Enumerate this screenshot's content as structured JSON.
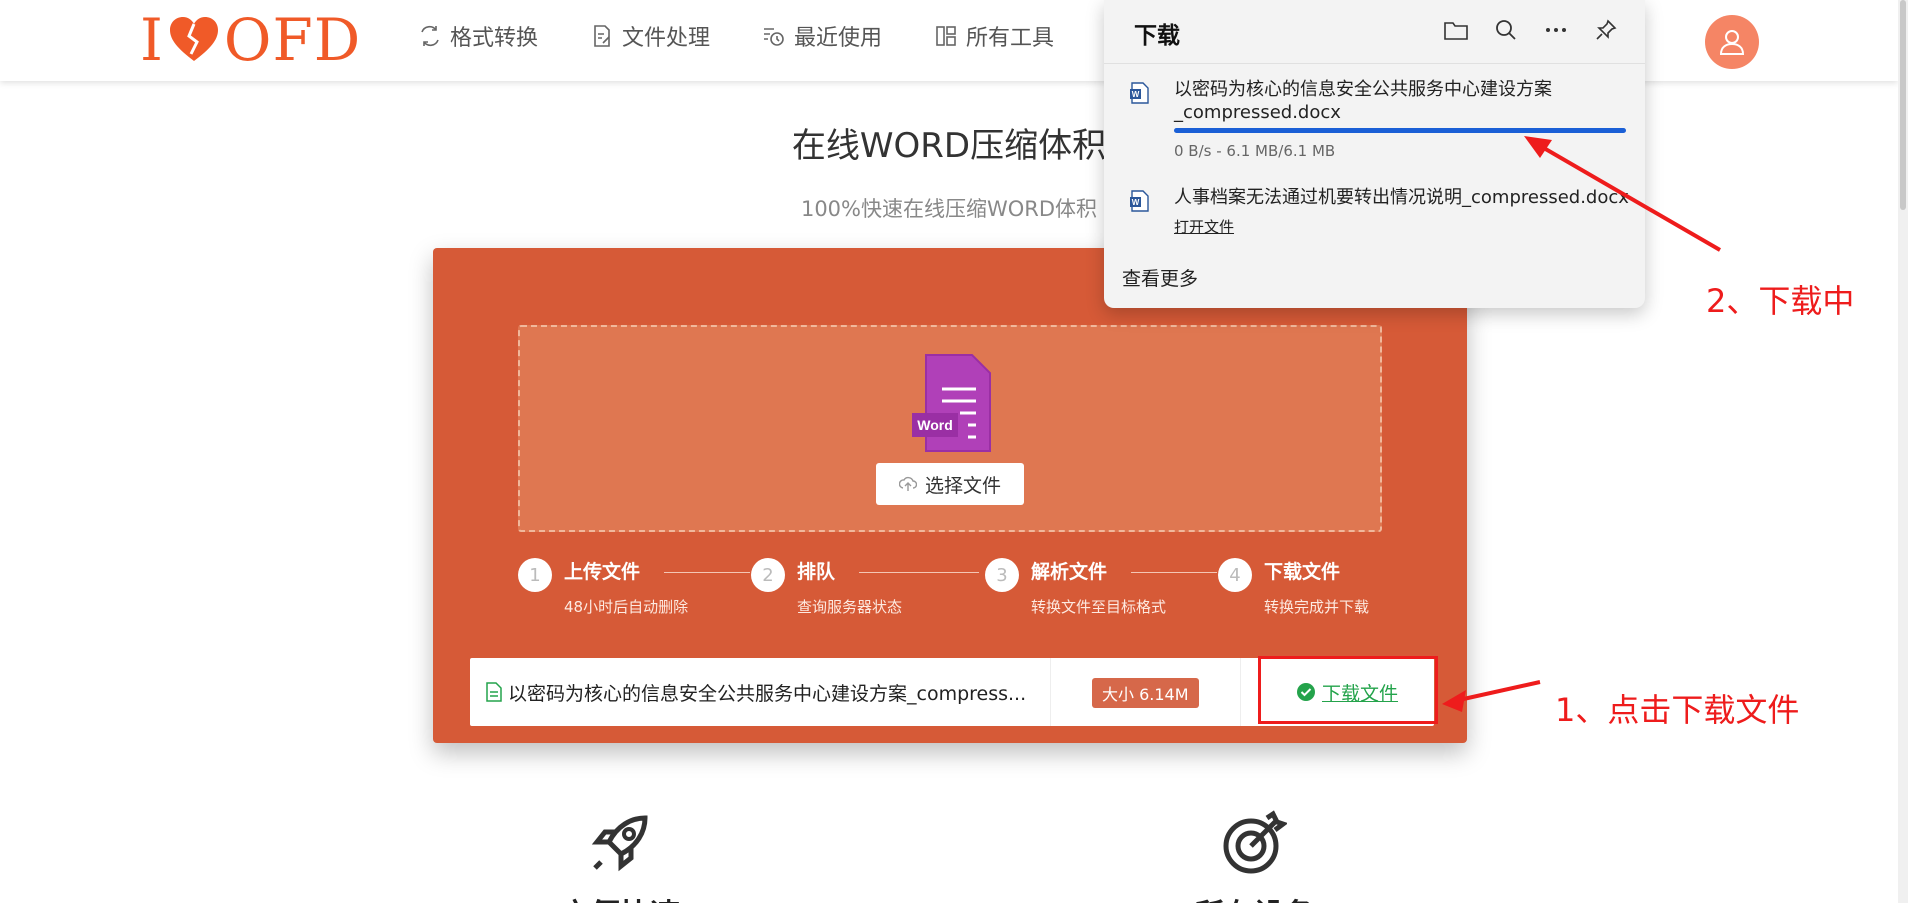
{
  "header": {
    "logo": {
      "pre": "I",
      "post": "OFD"
    },
    "nav": [
      {
        "label": "格式转换",
        "icon": "convert-icon"
      },
      {
        "label": "文件处理",
        "icon": "file-edit-icon"
      },
      {
        "label": "最近使用",
        "icon": "history-icon"
      },
      {
        "label": "所有工具",
        "icon": "grid-icon"
      }
    ],
    "avatar_icon": "user-icon"
  },
  "main": {
    "title": "在线WORD压缩体积",
    "subtitle": "100%快速在线压缩WORD体积",
    "upload": {
      "badge": "Word",
      "select_label": "选择文件"
    },
    "steps": [
      {
        "num": "1",
        "title": "上传文件",
        "desc": "48小时后自动删除"
      },
      {
        "num": "2",
        "title": "排队",
        "desc": "查询服务器状态"
      },
      {
        "num": "3",
        "title": "解析文件",
        "desc": "转换文件至目标格式"
      },
      {
        "num": "4",
        "title": "下载文件",
        "desc": "转换完成并下载"
      }
    ],
    "file": {
      "name": "以密码为核心的信息安全公共服务中心建设方案_compress...",
      "size": "大小 6.14M",
      "download_label": "下载文件"
    },
    "features": [
      {
        "title": "方便快速",
        "icon": "rocket-icon"
      },
      {
        "title": "所有设备",
        "icon": "target-icon"
      }
    ]
  },
  "downloads_popup": {
    "title": "下载",
    "items": [
      {
        "name": "以密码为核心的信息安全公共服务中心建设方案_compressed.docx",
        "status": "0 B/s - 6.1 MB/6.1 MB",
        "progress": 1.0
      },
      {
        "name": "人事档案无法通过机要转出情况说明_compressed.docx",
        "action": "打开文件"
      }
    ],
    "see_more": "查看更多"
  },
  "annotations": {
    "step1": "1、点击下载文件",
    "step2": "2、下载中"
  },
  "colors": {
    "brand": "#f05a28",
    "panel": "#d65a37",
    "dropzone": "#df7751",
    "success": "#24a34b",
    "annotation": "#ee1c1c",
    "progress": "#1a5fd6"
  }
}
